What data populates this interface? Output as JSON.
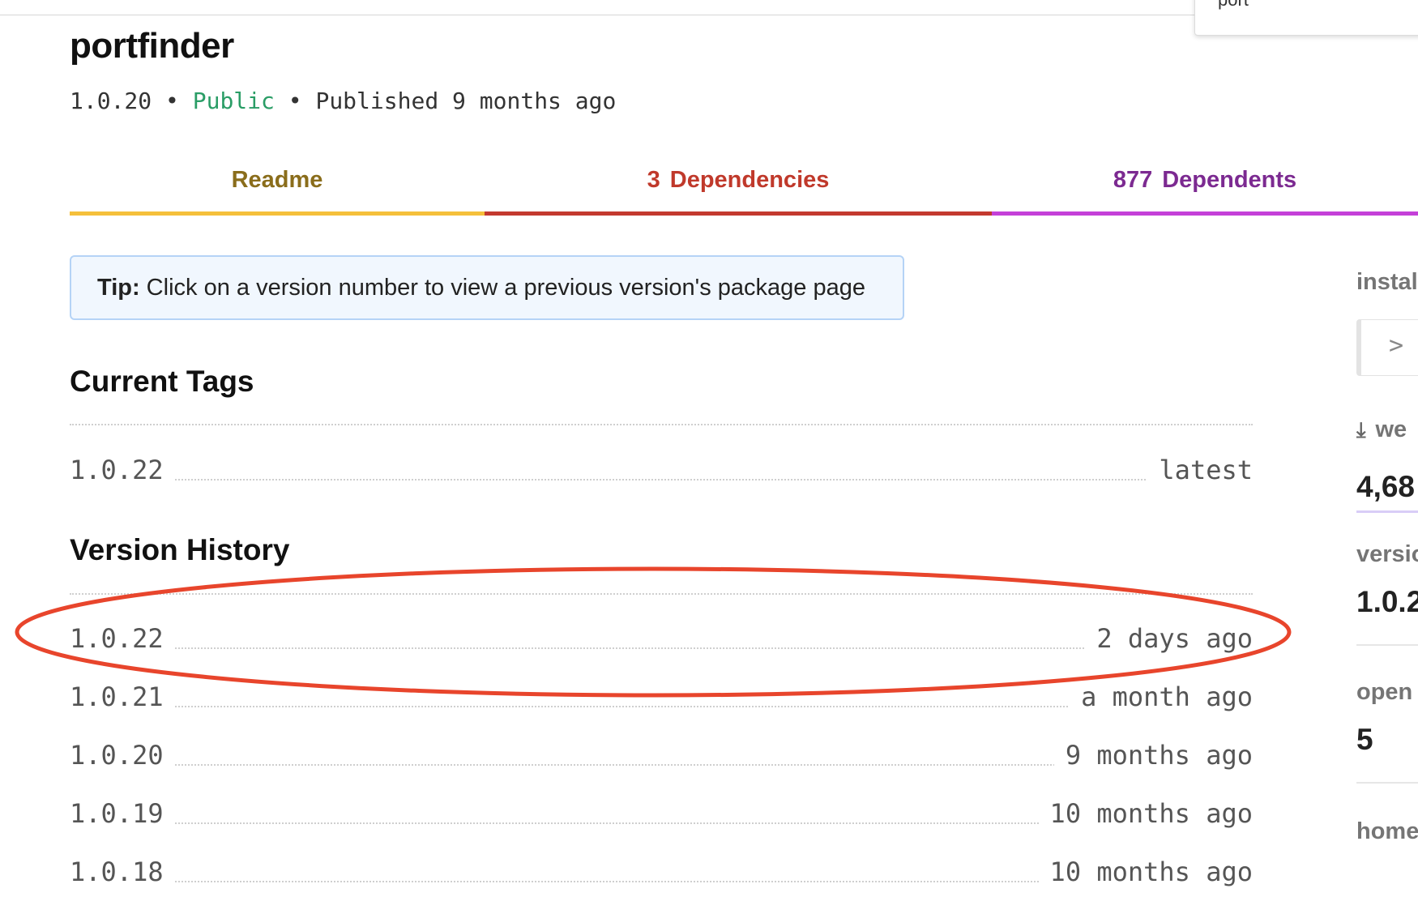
{
  "top_popup": {
    "text": "port"
  },
  "package": {
    "name": "portfinder",
    "version": "1.0.20",
    "visibility": "Public",
    "published": "Published 9 months ago",
    "separator": "•"
  },
  "tabs": [
    {
      "number": "",
      "label": "Readme"
    },
    {
      "number": "3",
      "label": "Dependencies"
    },
    {
      "number": "877",
      "label": "Dependents"
    }
  ],
  "tip": {
    "bold": "Tip:",
    "text": " Click on a version number to view a previous version's package page"
  },
  "current_tags": {
    "heading": "Current Tags",
    "rows": [
      {
        "version": "1.0.22",
        "tag": "latest"
      }
    ]
  },
  "version_history": {
    "heading": "Version History",
    "rows": [
      {
        "version": "1.0.22",
        "when": "2 days ago"
      },
      {
        "version": "1.0.21",
        "when": "a month ago"
      },
      {
        "version": "1.0.20",
        "when": "9 months ago"
      },
      {
        "version": "1.0.19",
        "when": "10 months ago"
      },
      {
        "version": "1.0.18",
        "when": "10 months ago"
      }
    ]
  },
  "sidebar": {
    "install_label": "instal",
    "install_prompt": ">",
    "weekly_label": "we",
    "weekly_value": "4,68",
    "version_label": "versio",
    "version_value": "1.0.2",
    "open_label": "open",
    "open_value": "5",
    "homepage_label": "home"
  },
  "annotation": {
    "color": "#e8452c"
  }
}
